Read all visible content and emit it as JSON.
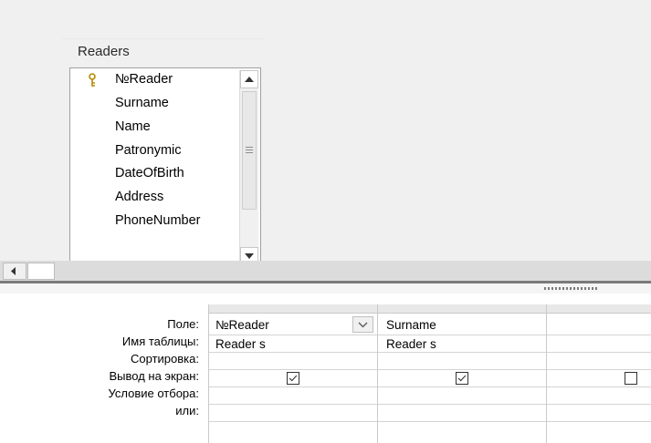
{
  "table": {
    "title": "Readers",
    "fields": [
      "№Reader",
      "Surname",
      "Name",
      "Patronymic",
      "DateOfBirth",
      "Address",
      "PhoneNumber"
    ],
    "key_field_icon": "key-icon"
  },
  "grid": {
    "row_labels": {
      "field": "Поле:",
      "table": "Имя таблицы:",
      "sort": "Сортировка:",
      "show": "Вывод на экран:",
      "criteria": "Условие отбора:",
      "or": "или:"
    },
    "columns": [
      {
        "field": "№Reader",
        "table": "Reader s",
        "show": true
      },
      {
        "field": "Surname",
        "table": "Reader s",
        "show": true
      },
      {
        "field": "",
        "table": "",
        "show": false
      }
    ]
  }
}
